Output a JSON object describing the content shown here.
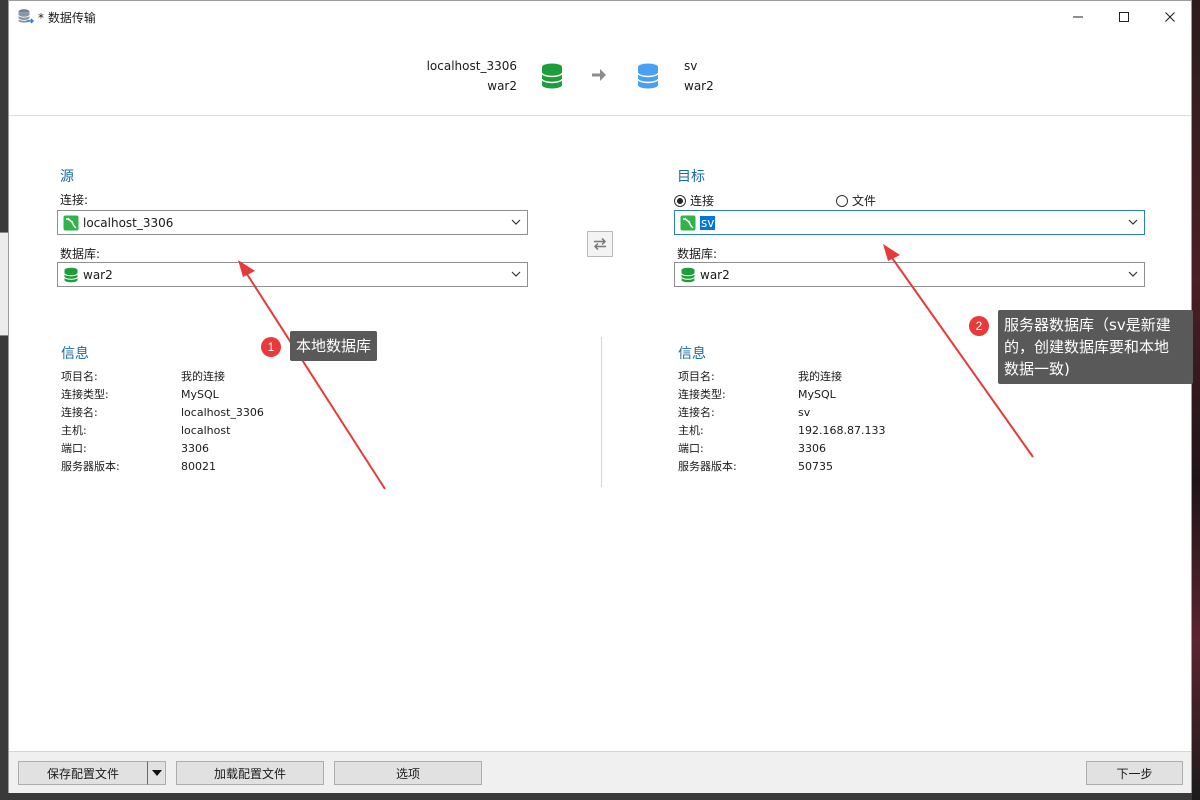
{
  "window": {
    "title": "* 数据传输",
    "minimize_icon": "minimize-icon",
    "maximize_icon": "maximize-icon",
    "close_icon": "close-icon"
  },
  "header": {
    "source_connection": "localhost_3306",
    "source_database": "war2",
    "target_connection": "sv",
    "target_database": "war2",
    "source_db_color": "#1e9e3a",
    "target_db_color": "#4aa0f0",
    "arrow_icon": "arrow-right-icon"
  },
  "source": {
    "section_title": "源",
    "connection_label": "连接:",
    "connection_value": "localhost_3306",
    "database_label": "数据库:",
    "database_value": "war2"
  },
  "target": {
    "section_title": "目标",
    "radio_connection": "连接",
    "radio_file": "文件",
    "selected_mode": "连接",
    "connection_value": "sv",
    "database_label": "数据库:",
    "database_value": "war2"
  },
  "source_info": {
    "title": "信息",
    "rows": [
      {
        "key": "项目名:",
        "value": "我的连接"
      },
      {
        "key": "连接类型:",
        "value": "MySQL"
      },
      {
        "key": "连接名:",
        "value": "localhost_3306"
      },
      {
        "key": "主机:",
        "value": "localhost"
      },
      {
        "key": "端口:",
        "value": "3306"
      },
      {
        "key": "服务器版本:",
        "value": "80021"
      }
    ]
  },
  "target_info": {
    "title": "信息",
    "rows": [
      {
        "key": "项目名:",
        "value": "我的连接"
      },
      {
        "key": "连接类型:",
        "value": "MySQL"
      },
      {
        "key": "连接名:",
        "value": "sv"
      },
      {
        "key": "主机:",
        "value": "192.168.87.133"
      },
      {
        "key": "端口:",
        "value": "3306"
      },
      {
        "key": "服务器版本:",
        "value": "50735"
      }
    ]
  },
  "annotations": [
    {
      "number": "1",
      "text": "本地数据库"
    },
    {
      "number": "2",
      "text_lines": [
        "服务器数据库（sv是新建",
        "的，创建数据库要和本地",
        "数据一致)"
      ]
    }
  ],
  "footer": {
    "save_profile": "保存配置文件",
    "load_profile": "加载配置文件",
    "options": "选项",
    "next": "下一步"
  },
  "colors": {
    "accent_title": "#1a6aa8",
    "annotation_red": "#e83a3a",
    "callout_bg": "#595959",
    "selection_blue": "#0078d7"
  }
}
